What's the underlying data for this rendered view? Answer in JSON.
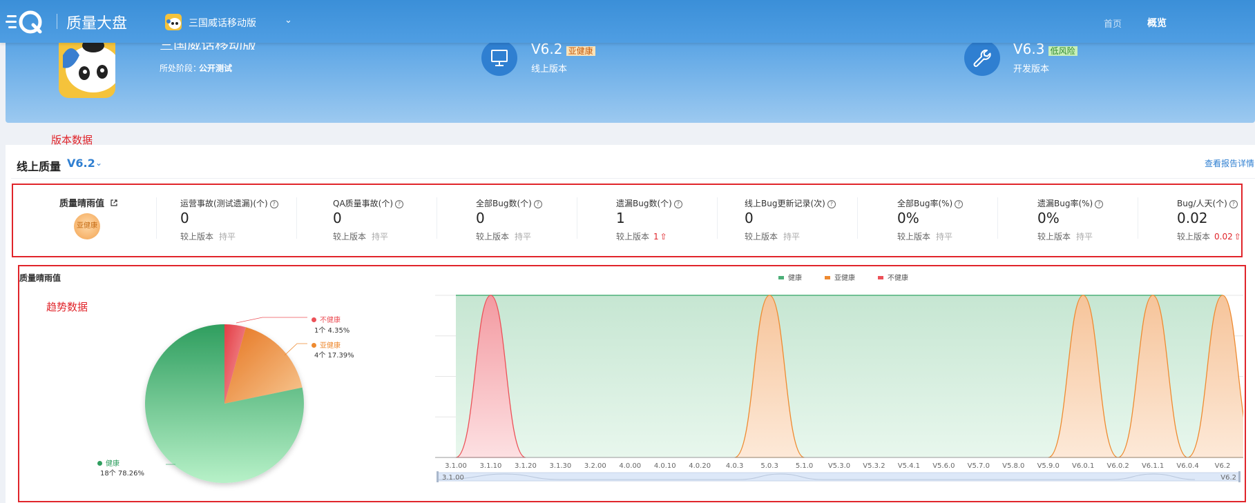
{
  "topbar": {
    "logo_text": "质量大盘",
    "project_name": "三国威话移动版",
    "caret": "⌄",
    "nav": {
      "home": "首页",
      "overview": "概览"
    }
  },
  "banner": {
    "app_title": "三国威话移动版",
    "stage_label": "所处阶段：",
    "stage_value": "公开测试",
    "online_version": {
      "number": "V6.2",
      "tag": "亚健康",
      "label": "线上版本",
      "icon": "monitor-icon"
    },
    "dev_version": {
      "number": "V6.3",
      "tag": "低风险",
      "label": "开发版本",
      "icon": "wrench-icon"
    }
  },
  "annotations": {
    "version_data": "版本数据",
    "trend_data": "趋势数据"
  },
  "colors": {
    "healthy": "#4caf78",
    "subhealthy": "#ee8a30",
    "unhealthy": "#ec5158",
    "accent": "#2f7fd1",
    "annotation": "#e0242a"
  },
  "quality": {
    "title": "线上质量",
    "version": "V6.2",
    "caret": "⌄",
    "report_link": "查看报告详情 ›",
    "weather": {
      "label": "质量晴雨值",
      "icon": "external-link-icon",
      "badge": "亚健康"
    },
    "metrics": [
      {
        "label": "运营事故(测试遗漏)(个)",
        "value": "0",
        "compare_label": "较上版本",
        "compare_status": "持平"
      },
      {
        "label": "QA质量事故(个)",
        "value": "0",
        "compare_label": "较上版本",
        "compare_status": "持平"
      },
      {
        "label": "全部Bug数(个)",
        "value": "0",
        "compare_label": "较上版本",
        "compare_status": "持平"
      },
      {
        "label": "遗漏Bug数(个)",
        "value": "1",
        "compare_label": "较上版本",
        "compare_status": "1",
        "trend": "up"
      },
      {
        "label": "线上Bug更新记录(次)",
        "value": "0",
        "compare_label": "较上版本",
        "compare_status": "持平"
      },
      {
        "label": "全部Bug率(%)",
        "value": "0%",
        "compare_label": "较上版本",
        "compare_status": "持平"
      },
      {
        "label": "遗漏Bug率(%)",
        "value": "0%",
        "compare_label": "较上版本",
        "compare_status": "持平"
      },
      {
        "label": "Bug/人天(个)",
        "value": "0.02",
        "compare_label": "较上版本",
        "compare_status": "0.02",
        "trend": "up"
      }
    ]
  },
  "trend": {
    "title": "质量晴雨值"
  },
  "chart_data": [
    {
      "type": "pie",
      "slices": [
        {
          "name": "健康",
          "count_label": "18个 78.26%",
          "value": 18,
          "percent": 78.26,
          "color": "#4caf78"
        },
        {
          "name": "亚健康",
          "count_label": "4个 17.39%",
          "value": 4,
          "percent": 17.39,
          "color": "#ee8a30"
        },
        {
          "name": "不健康",
          "count_label": "1个 4.35%",
          "value": 1,
          "percent": 4.35,
          "color": "#ec5158"
        }
      ]
    },
    {
      "type": "area",
      "legend": [
        "健康",
        "亚健康",
        "不健康"
      ],
      "legend_position": "top-center",
      "categories": [
        "3.1.00",
        "3.1.10",
        "3.1.20",
        "3.1.30",
        "3.2.00",
        "4.0.00",
        "4.0.10",
        "4.0.20",
        "4.0.3",
        "5.0.3",
        "5.1.0",
        "V5.3.0",
        "V5.3.2",
        "V5.4.1",
        "V5.6.0",
        "V5.7.0",
        "V5.8.0",
        "V5.9.0",
        "V6.0.1",
        "V6.0.2",
        "V6.1.1",
        "V6.0.4",
        "V6.2"
      ],
      "status": [
        "健康",
        "不健康",
        "健康",
        "健康",
        "健康",
        "健康",
        "健康",
        "健康",
        "健康",
        "亚健康",
        "健康",
        "健康",
        "健康",
        "健康",
        "健康",
        "健康",
        "健康",
        "健康",
        "亚健康",
        "健康",
        "亚健康",
        "健康",
        "亚健康"
      ],
      "slider": {
        "start": "3.1.00",
        "end": "V6.2"
      }
    }
  ]
}
